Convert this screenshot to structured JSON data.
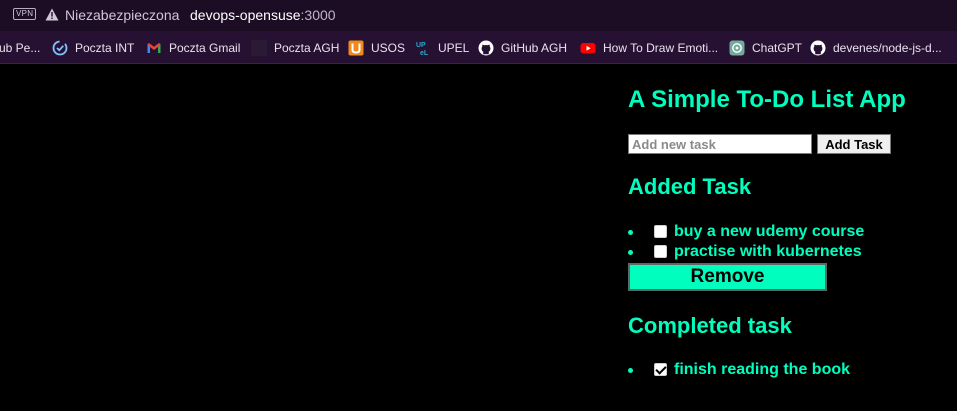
{
  "browser": {
    "vpn_label": "VPN",
    "security_text": "Niezabezpieczona",
    "url_host": "devops-opensuse",
    "url_port": ":3000"
  },
  "bookmarks": [
    {
      "label": "ub Pe...",
      "icon": "none"
    },
    {
      "label": "Poczta INT",
      "icon": "mail-check-icon"
    },
    {
      "label": "Poczta Gmail",
      "icon": "gmail-icon"
    },
    {
      "label": "Poczta AGH",
      "icon": "dark-site-icon"
    },
    {
      "label": "USOS",
      "icon": "usos-icon"
    },
    {
      "label": "UPEL",
      "icon": "upel-icon"
    },
    {
      "label": "GitHub AGH",
      "icon": "github-icon"
    },
    {
      "label": "How To Draw Emoti...",
      "icon": "youtube-icon"
    },
    {
      "label": "ChatGPT",
      "icon": "chatgpt-icon"
    },
    {
      "label": "devenes/node-js-d...",
      "icon": "github-icon"
    }
  ],
  "app": {
    "title": "A Simple To-Do List App",
    "new_task_placeholder": "Add new task",
    "new_task_value": "",
    "add_button": "Add Task",
    "added_heading": "Added Task",
    "added_tasks": [
      {
        "text": "buy a new udemy course",
        "done": false
      },
      {
        "text": "practise with kubernetes",
        "done": false
      }
    ],
    "remove_button": "Remove",
    "completed_heading": "Completed task",
    "completed_tasks": [
      {
        "text": "finish reading the book",
        "done": true
      }
    ]
  },
  "colors": {
    "accent": "#00ffbf",
    "chrome_bg": "#1c0d24",
    "bookmarks_bg": "#261132",
    "page_bg": "#000000"
  }
}
